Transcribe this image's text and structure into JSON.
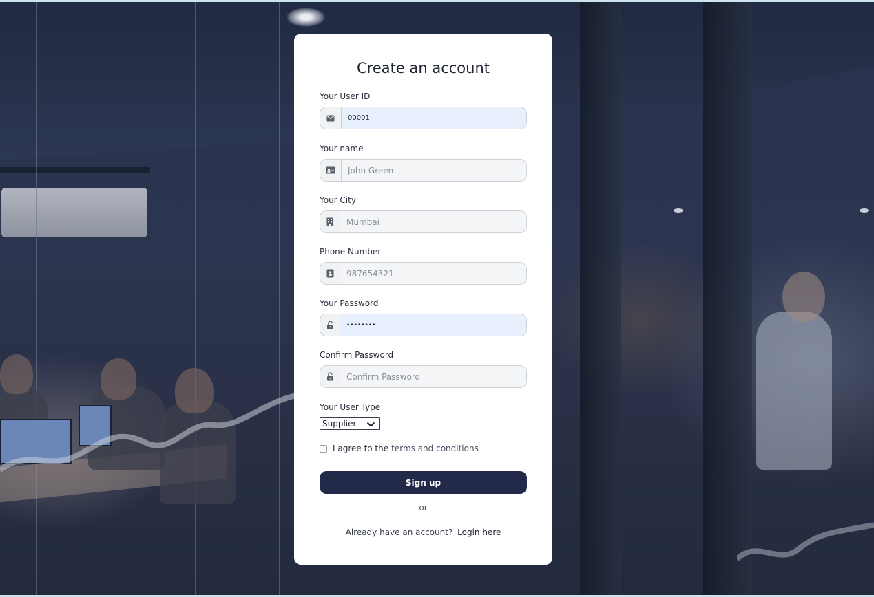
{
  "page": {
    "title": "Create an account"
  },
  "form": {
    "user_id": {
      "label": "Your User ID",
      "value": "00001",
      "placeholder": ""
    },
    "name": {
      "label": "Your name",
      "value": "",
      "placeholder": "John Green"
    },
    "city": {
      "label": "Your City",
      "value": "",
      "placeholder": "Mumbai"
    },
    "phone": {
      "label": "Phone Number",
      "value": "",
      "placeholder": "987654321"
    },
    "password": {
      "label": "Your Password",
      "value": "••••••••",
      "placeholder": ""
    },
    "confirm_password": {
      "label": "Confirm Password",
      "value": "",
      "placeholder": "Confirm Password"
    },
    "user_type": {
      "label": "Your User Type",
      "selected": "Supplier"
    },
    "agree": {
      "prefix": "I agree to the",
      "link": "terms and conditions",
      "checked": false
    },
    "submit_label": "Sign up",
    "or_text": "or",
    "login_prompt": "Already have an account?",
    "login_link": "Login here"
  },
  "icons": {
    "user_id": "envelope-icon",
    "name": "id-card-icon",
    "city": "building-icon",
    "phone": "contact-book-icon",
    "password": "unlock-icon",
    "confirm_password": "unlock-icon"
  },
  "colors": {
    "button_bg": "#232948",
    "card_bg": "#ffffff",
    "autofill_bg": "#e8f0fe",
    "page_bg": "#243049"
  }
}
